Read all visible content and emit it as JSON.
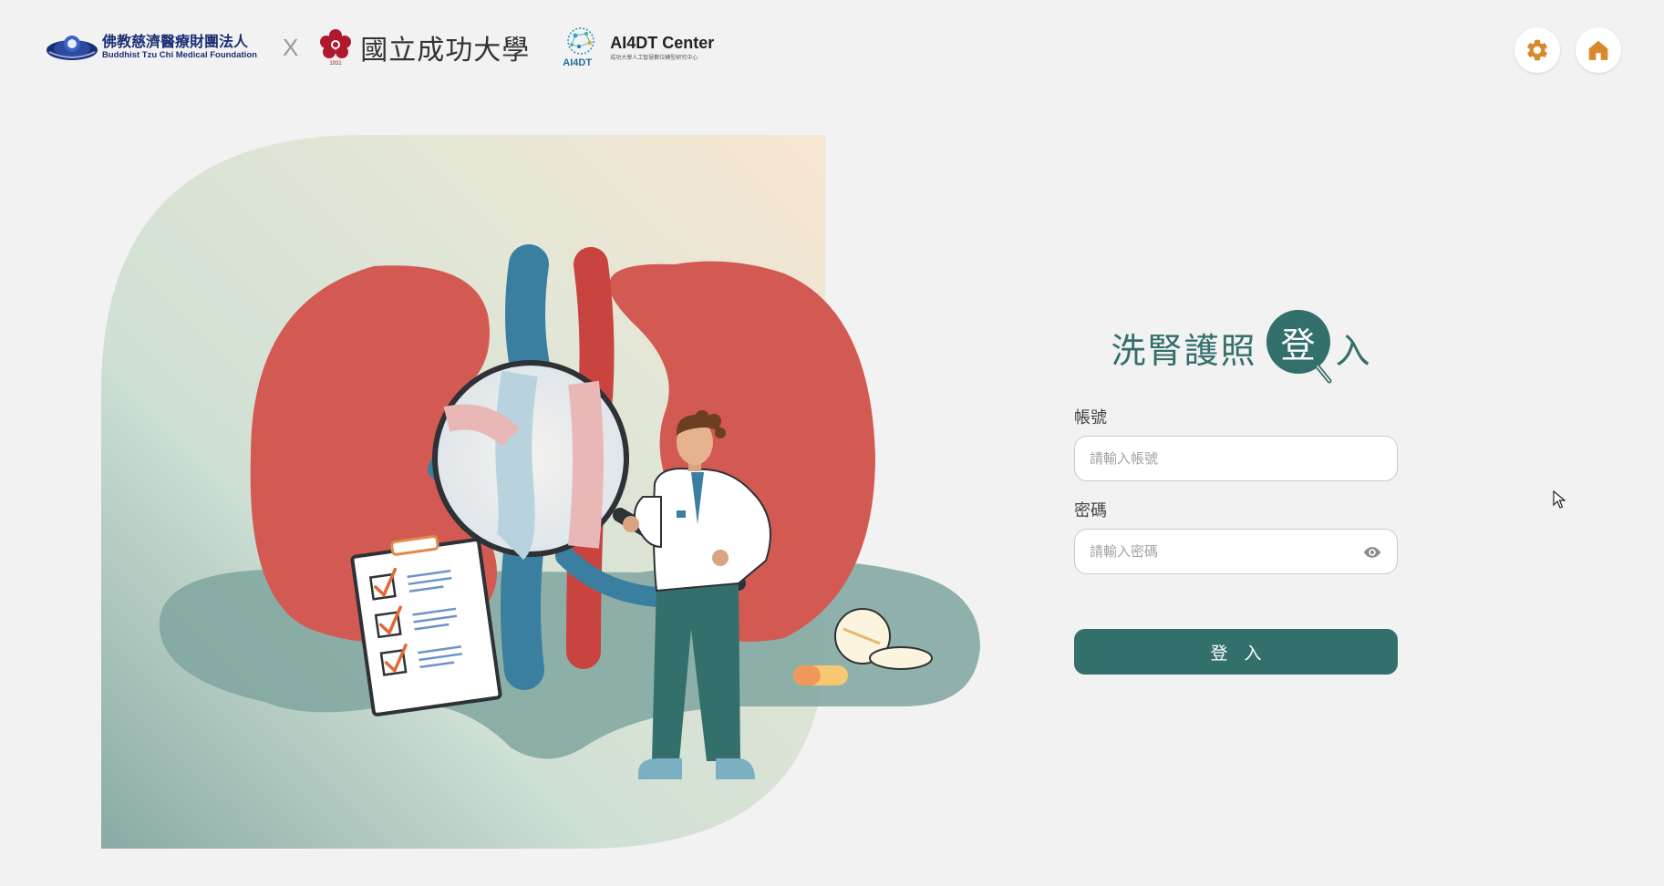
{
  "header": {
    "tzuchi": {
      "name_cn": "佛教慈濟醫療財團法人",
      "name_en": "Buddhist Tzu Chi Medical Foundation"
    },
    "separator": "X",
    "ncku": {
      "name": "國立成功大學",
      "year": "1931"
    },
    "ai4dt": {
      "title": "AI4DT Center",
      "mark": "AI4DT",
      "subtitle": "成功大學人工智慧數位轉型研究中心"
    },
    "settings_icon": "gear-icon",
    "home_icon": "home-icon"
  },
  "login": {
    "title": "洗腎護照",
    "badge_char": "登",
    "title_tail": "入",
    "account_label": "帳號",
    "account_placeholder": "請輸入帳號",
    "password_label": "密碼",
    "password_placeholder": "請輸入密碼",
    "password_toggle_icon": "eye-icon",
    "submit_label": "登入"
  },
  "colors": {
    "primary": "#336f6b",
    "accent": "#d9892b",
    "background": "#f2f2f2",
    "kidney": "#d35a52"
  }
}
